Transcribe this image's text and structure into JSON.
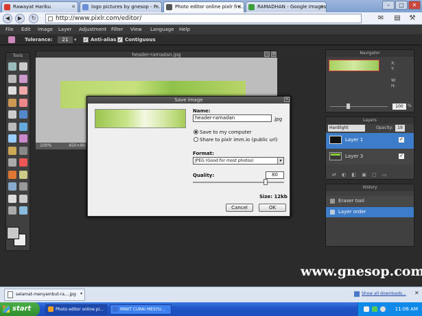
{
  "browser": {
    "tabs": [
      {
        "label": "Rawayat Hariku",
        "favicon_color": "#d63a2a"
      },
      {
        "label": "logo pictures by gnesop - P...",
        "favicon_color": "#6b8ed6"
      },
      {
        "label": "Photo editor online pixlr fre...",
        "favicon_color": "#555555",
        "active": true
      },
      {
        "label": "RAMADHAN - Google Images",
        "favicon_color": "#3e9e3e"
      }
    ],
    "url": "http://www.pixlr.com/editor/",
    "window_buttons": {
      "minimize": "–",
      "maximize": "□",
      "close": "✕"
    }
  },
  "app": {
    "menu": [
      "File",
      "Edit",
      "Image",
      "Layer",
      "Adjustment",
      "Filter",
      "View",
      "Language",
      "Help"
    ],
    "options": {
      "tolerance_label": "Tolerance:",
      "tolerance_value": "21",
      "antialias_label": "Anti-alias",
      "antialias_checked": true,
      "contiguous_label": "Contiguous",
      "contiguous_checked": true
    },
    "tools_title": "Tools",
    "document": {
      "title": "header-ramadan.jpg",
      "zoom": "100%",
      "size": "450×90"
    },
    "navigator": {
      "title": "Navigator",
      "x_label": "X:",
      "y_label": "Y:",
      "w_label": "W:",
      "h_label": "H:",
      "zoom": "100",
      "zoom_unit": "%"
    },
    "layers": {
      "title": "Layers",
      "blend_mode": "Hardlight",
      "opacity_label": "Opacity:",
      "opacity_value": "19",
      "items": [
        {
          "name": "Layer 1",
          "selected": true
        },
        {
          "name": "Layer 3",
          "selected": false
        }
      ]
    },
    "history": {
      "title": "History",
      "items": [
        {
          "name": "Eraser tool",
          "selected": false
        },
        {
          "name": "Layer order",
          "selected": true
        }
      ]
    }
  },
  "dialog": {
    "title": "Save image",
    "name_label": "Name:",
    "name_value": "header-ramadan",
    "extension": ".jpg",
    "save_computer_label": "Save to my computer",
    "share_label": "Share to pixlr imm.io (public url)",
    "format_label": "Format:",
    "format_value": "JPEG (Good for most photos)",
    "quality_label": "Quality:",
    "quality_value": "80",
    "quality_fraction": 0.8,
    "size_label": "Size: 12kb",
    "cancel_label": "Cancel",
    "ok_label": "OK"
  },
  "watermark": "www.gnesop.com",
  "download_bar": {
    "file": "selamat-menyambut-ra....jpg",
    "show_all": "Show all downloads...",
    "close": "✕"
  },
  "taskbar": {
    "start": "start",
    "tasks": [
      {
        "label": "Photo editor online pi...",
        "active": true,
        "icon_color": "#f0a020"
      },
      {
        "label": "MINIT CURAI MESYU...",
        "active": false,
        "icon_color": "#3a6fd6"
      }
    ],
    "clock": "11:06 AM"
  }
}
